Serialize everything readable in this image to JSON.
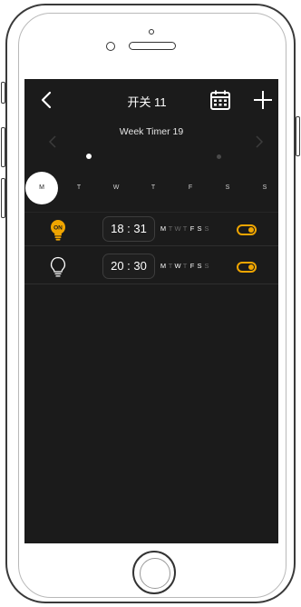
{
  "header": {
    "title": "开关 11",
    "back_icon": "chevron-left-icon",
    "calendar_icon": "calendar-icon",
    "add_icon": "plus-icon"
  },
  "timer_pager": {
    "title": "Week Timer 19",
    "page_count": 2,
    "active_page": 1
  },
  "day_selector": {
    "days": [
      "M",
      "T",
      "W",
      "T",
      "F",
      "S",
      "S"
    ],
    "selected_index": 0
  },
  "timers": [
    {
      "bulb_state": "ON",
      "bulb_icon": "bulb-on-icon",
      "time": "18 : 31",
      "weekdays": [
        "M",
        "T",
        "W",
        "T",
        "F",
        "S",
        "S"
      ],
      "weekdays_active": [
        true,
        false,
        false,
        false,
        true,
        true,
        false
      ],
      "enabled": true
    },
    {
      "bulb_state": "",
      "bulb_icon": "bulb-off-icon",
      "time": "20 : 30",
      "weekdays": [
        "M",
        "T",
        "W",
        "T",
        "F",
        "S",
        "S"
      ],
      "weekdays_active": [
        true,
        false,
        true,
        false,
        true,
        true,
        false
      ],
      "enabled": true
    }
  ],
  "colors": {
    "screen_bg": "#1b1b1b",
    "accent": "#f0a500",
    "text": "#ffffff",
    "inactive_text": "#6a6a6a"
  }
}
